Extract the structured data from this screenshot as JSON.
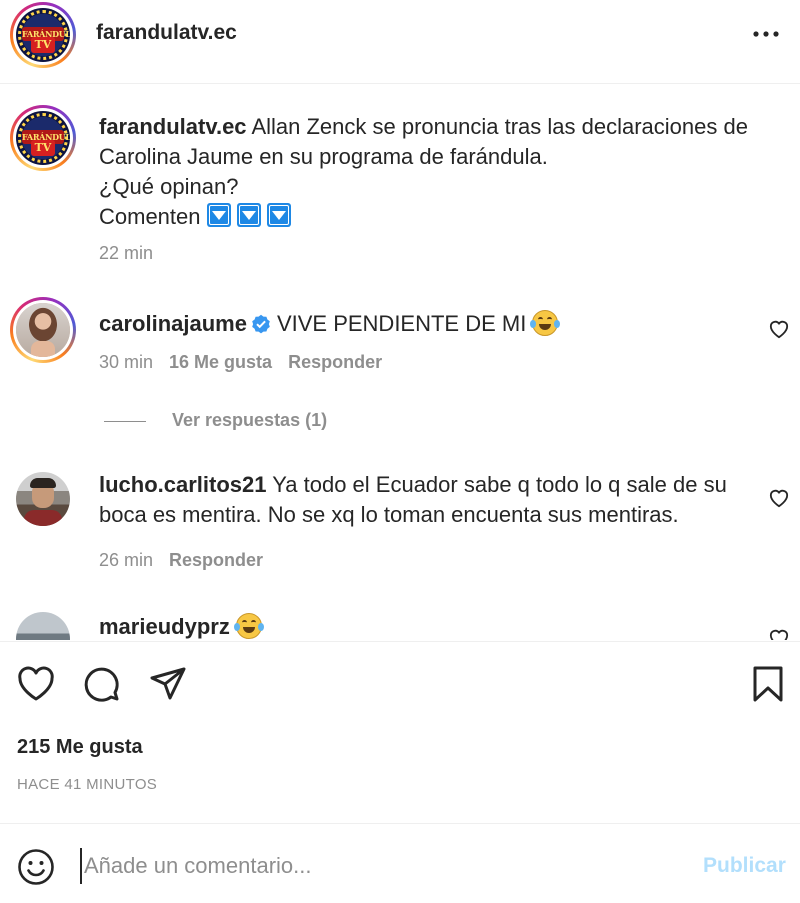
{
  "header": {
    "username": "farandulatv.ec",
    "more_icon": "more-horizontal-icon"
  },
  "logo_text": {
    "word": "FARÁNDULA",
    "tv": "TV"
  },
  "caption": {
    "username": "farandulatv.ec",
    "line1": "Allan Zenck se pronuncia tras las declaraciones de",
    "line2": "Carolina Jaume en su programa de farándula.",
    "line3": "¿Qué opinan?",
    "line4": "Comenten",
    "time": "22 min"
  },
  "comments": [
    {
      "username": "carolinajaume",
      "text": "VIVE PENDIENTE DE MI",
      "time": "30 min",
      "likes": "16 Me gusta",
      "reply": "Responder",
      "view_replies": "Ver respuestas (1)"
    },
    {
      "username": "lucho.carlitos21",
      "text_line1": "Ya todo el Ecuador sabe q todo lo q sale de su",
      "text_line2": "boca es mentira. No se xq lo toman encuenta sus mentiras.",
      "time": "26 min",
      "reply": "Responder"
    },
    {
      "username": "marieudyprz"
    }
  ],
  "actions": {
    "likes": "215 Me gusta",
    "timestamp": "HACE 41 MINUTOS"
  },
  "composer": {
    "placeholder": "Añade un comentario...",
    "publish": "Publicar"
  },
  "colors": {
    "accent_disabled": "#b2dffc",
    "verified": "#3897f0",
    "arrow_box": "#1e88e5"
  }
}
